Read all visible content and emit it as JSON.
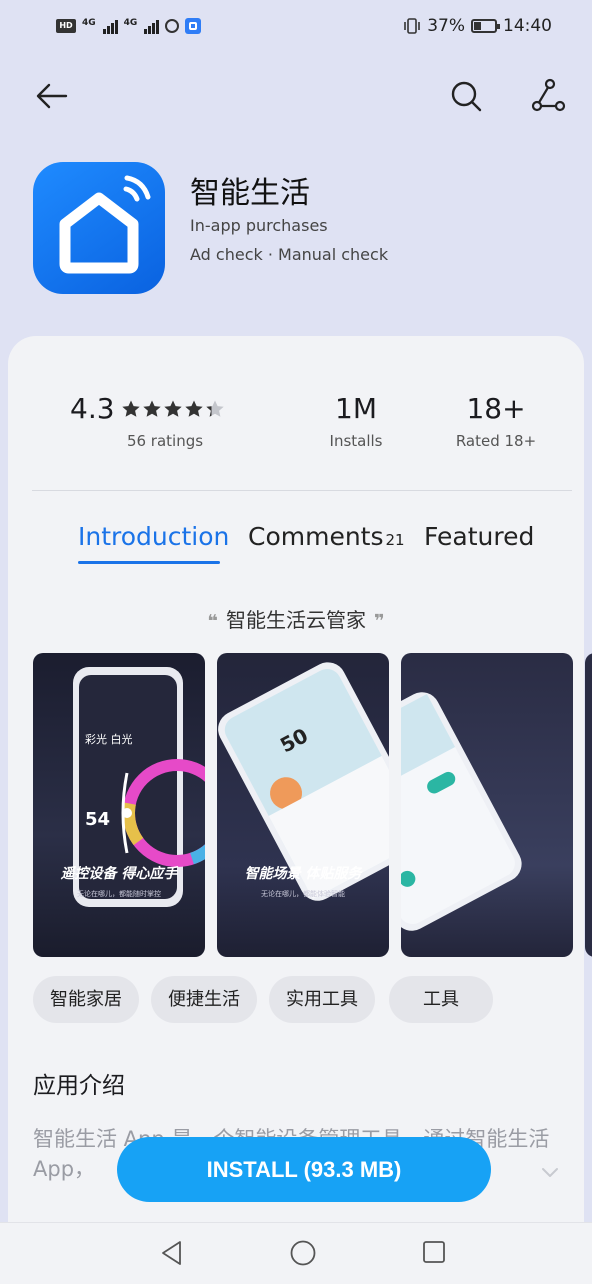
{
  "status_bar": {
    "signal1_label": "4G",
    "signal2_label": "4G",
    "battery_percent": "37%",
    "time": "14:40"
  },
  "app": {
    "name": "智能生活",
    "purchases": "In-app purchases",
    "checks": "Ad check · Manual check"
  },
  "stats": {
    "rating": "4.3",
    "rating_value": 4.3,
    "ratings_label": "56 ratings",
    "installs": "1M",
    "installs_label": "Installs",
    "age": "18+",
    "age_label": "Rated 18+"
  },
  "tabs": {
    "introduction": "Introduction",
    "comments": "Comments",
    "comments_count": "21",
    "featured": "Featured"
  },
  "tagline": "智能生活云管家",
  "screenshots": [
    {
      "caption": "遥控设备 得心应手",
      "sub": "无论在哪儿，都能随时掌控"
    },
    {
      "caption": "智能场景 体贴服务",
      "sub": "无论在哪儿，都能体验智能"
    }
  ],
  "tags": [
    "智能家居",
    "便捷生活",
    "实用工具",
    "工具"
  ],
  "intro": {
    "title": "应用介绍",
    "body": "智能生活 App 是一个智能设备管理工具，通过智能生活 App，"
  },
  "install_button": "INSTALL (93.3 MB)",
  "colors": {
    "accent": "#1a73e8",
    "install": "#17a2f5",
    "header_bg": "#dfe2f3",
    "card_bg": "#f2f3f6"
  },
  "icons": [
    "back-arrow-icon",
    "search-icon",
    "share-icon",
    "app-home-icon",
    "chevron-down-icon",
    "nav-back-icon",
    "nav-home-icon",
    "nav-recent-icon"
  ]
}
